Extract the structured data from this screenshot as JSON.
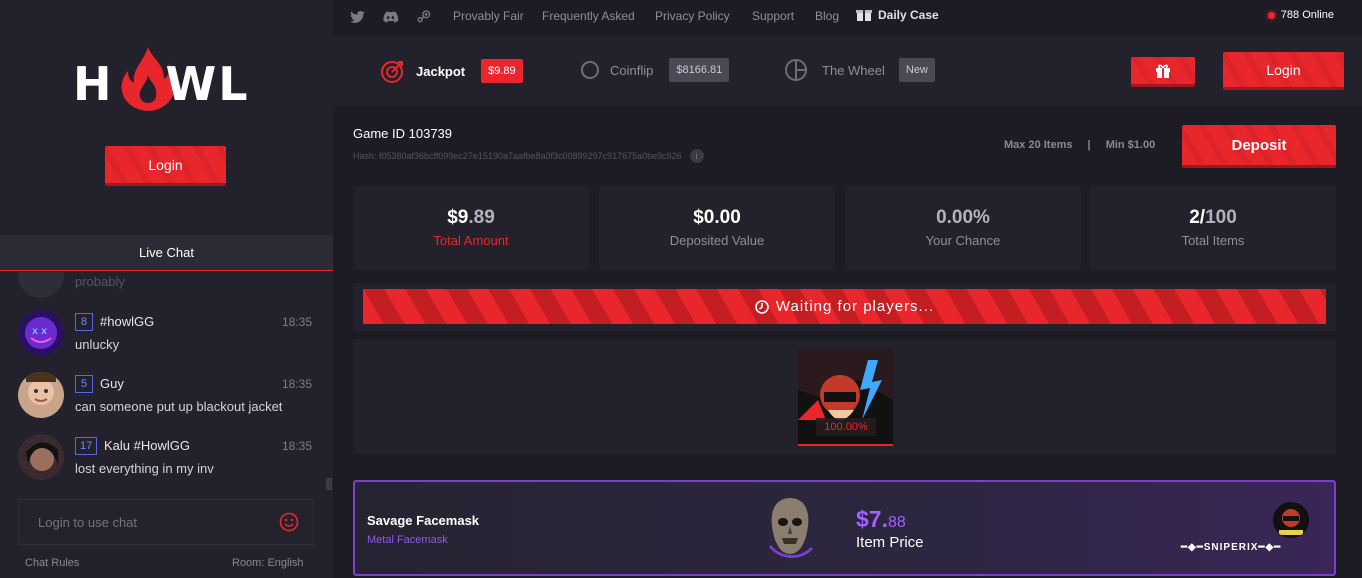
{
  "sidebar": {
    "logo_text": "HOWL",
    "login_label": "Login",
    "live_chat_title": "Live Chat",
    "ghost_message": "probably",
    "messages": [
      {
        "level": "8",
        "name": "#howlGG",
        "time": "18:35",
        "text": "unlucky"
      },
      {
        "level": "5",
        "name": "Guy",
        "time": "18:35",
        "text": "can someone put up blackout jacket"
      },
      {
        "level": "17",
        "name": "Kalu #HowlGG",
        "time": "18:35",
        "text": "lost everything in my inv"
      }
    ],
    "chat_placeholder": "Login to use chat",
    "chat_rules": "Chat Rules",
    "room": "Room: English"
  },
  "topnav": {
    "social_icons": [
      "twitter-icon",
      "discord-icon",
      "steam-icon"
    ],
    "links": [
      "Provably Fair",
      "Frequently Asked",
      "Privacy Policy",
      "Support",
      "Blog"
    ],
    "daily_case": "Daily Case",
    "online": "788 Online"
  },
  "gamebar": {
    "jackpot": {
      "label": "Jackpot",
      "badge": "$9.89"
    },
    "coinflip": {
      "label": "Coinflip",
      "badge": "$8166.81"
    },
    "wheel": {
      "label": "The Wheel",
      "badge": "New"
    },
    "login_label": "Login"
  },
  "game": {
    "id_label": "Game ID 103739",
    "hash": "Hash: f05380af36bcff099ec27e15190a7aafbe8a0f3c00899297c917675a0be9c926",
    "max_items": "Max 20 Items",
    "separator": "|",
    "min_value": "Min $1.00",
    "deposit_label": "Deposit"
  },
  "stats": [
    {
      "value_main": "$9",
      "value_rest": ".89",
      "label": "Total Amount"
    },
    {
      "value_main": "$0.00",
      "value_rest": "",
      "label": "Deposited Value"
    },
    {
      "value_main": "0.00%",
      "value_rest": "",
      "label": "Your Chance"
    },
    {
      "value_main": "2/",
      "value_rest": "100",
      "label": "Total Items"
    }
  ],
  "waiting_text": "Waiting for players...",
  "player": {
    "chance": "100.00%"
  },
  "item": {
    "name": "Savage Facemask",
    "category": "Metal Facemask",
    "price_main": "$7.",
    "price_cents": "88",
    "price_label": "Item Price",
    "owner": "SNIPERIX"
  },
  "colors": {
    "accent": "#e8262c",
    "purple": "#9156f0",
    "badge_gray": "#4a4955"
  }
}
